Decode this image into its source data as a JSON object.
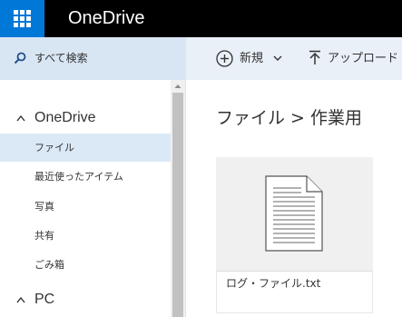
{
  "app": {
    "brand": "OneDrive"
  },
  "search": {
    "placeholder": "すべて検索"
  },
  "commands": {
    "new_label": "新規",
    "upload_label": "アップロード"
  },
  "sidebar": {
    "sections": [
      {
        "label": "OneDrive",
        "expanded": true
      },
      {
        "label": "PC",
        "expanded": true
      }
    ],
    "items": [
      {
        "label": "ファイル",
        "active": true
      },
      {
        "label": "最近使ったアイテム",
        "active": false
      },
      {
        "label": "写真",
        "active": false
      },
      {
        "label": "共有",
        "active": false
      },
      {
        "label": "ごみ箱",
        "active": false
      }
    ]
  },
  "breadcrumb": {
    "root": "ファイル",
    "separator": ">",
    "current": "作業用"
  },
  "files": [
    {
      "name": "ログ・ファイル.txt",
      "icon": "text-document-icon"
    }
  ],
  "colors": {
    "topbar": "#000000",
    "waffle": "#0078d7",
    "cmdbar": "#e9f0f8",
    "active_item": "#dbe9f6"
  }
}
